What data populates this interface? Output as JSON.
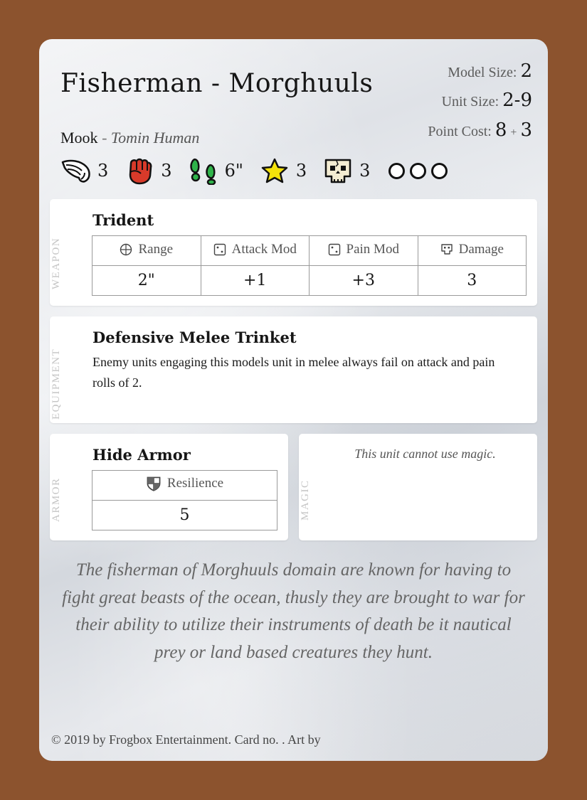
{
  "card": {
    "name": "Fisherman - Morghuuls",
    "model_size_label": "Model Size:",
    "model_size": "2",
    "unit_size_label": "Unit Size:",
    "unit_size": "2-9",
    "point_cost_label": "Point Cost:",
    "point_cost_base": "8",
    "point_cost_plus": "+",
    "point_cost_extra": "3",
    "type": "Mook",
    "type_separator": "-",
    "race": "Tomin Human"
  },
  "stats": {
    "wing": "3",
    "fist": "3",
    "move": "6\"",
    "star": "3",
    "skull": "3",
    "wound_count": 3
  },
  "weapon": {
    "section_label": "Weapon",
    "name": "Trident",
    "headers": [
      "Range",
      "Attack Mod",
      "Pain Mod",
      "Damage"
    ],
    "values": [
      "2\"",
      "+1",
      "+3",
      "3"
    ]
  },
  "equipment": {
    "section_label": "Equipment",
    "name": "Defensive Melee Trinket",
    "description": "Enemy units engaging this models unit in melee always fail on attack and pain rolls of 2."
  },
  "armor": {
    "section_label": "Armor",
    "name": "Hide Armor",
    "header": "Resilience",
    "value": "5"
  },
  "magic": {
    "section_label": "Magic",
    "note": "This unit cannot use magic."
  },
  "flavor_text": "The fisherman of Morghuuls domain are known for having to fight great beasts of the ocean, thusly they are brought to war for their ability to utilize their instruments of death be it nautical prey or land based creatures they hunt.",
  "footer": "© 2019 by Frogbox Entertainment. Card no. . Art by",
  "colors": {
    "background": "#8c532e",
    "card": "#e6e8ec",
    "fist": "#d83a2a",
    "boots": "#2fb34a",
    "star": "#f5e20a"
  }
}
